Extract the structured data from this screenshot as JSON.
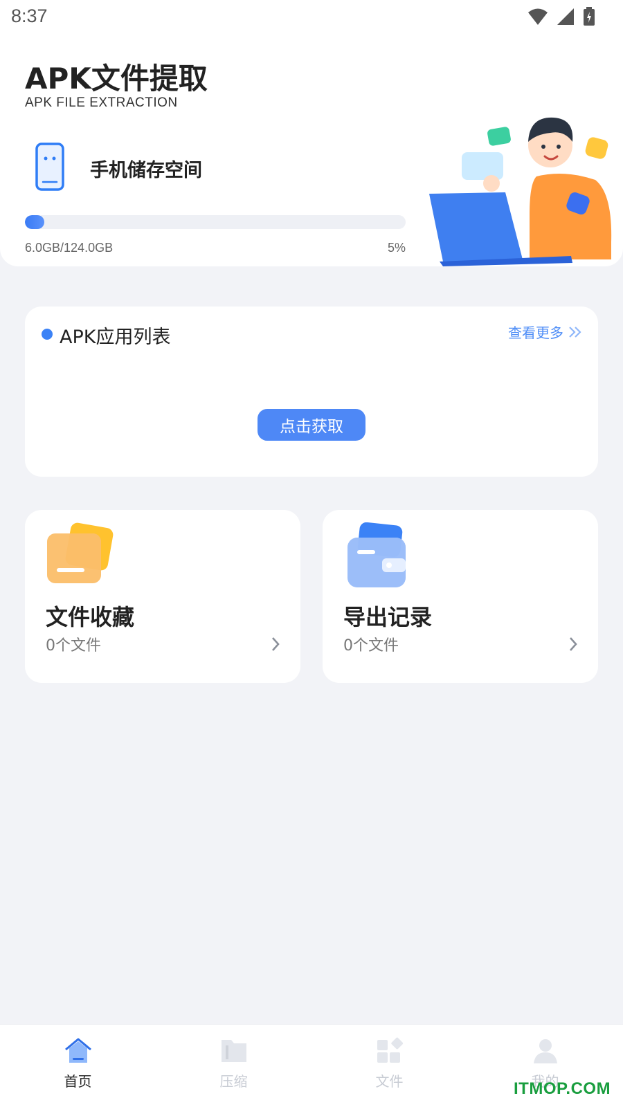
{
  "status_bar": {
    "time": "8:37"
  },
  "header": {
    "title": "APK文件提取",
    "subtitle": "APK FILE EXTRACTION"
  },
  "storage": {
    "label": "手机储存空间",
    "used_text": "6.0GB/124.0GB",
    "percent_text": "5%",
    "progress_fraction": 0.05
  },
  "apk_list": {
    "title": "APK应用列表",
    "more_label": "查看更多",
    "fetch_button": "点击获取"
  },
  "features": [
    {
      "title": "文件收藏",
      "count": "0个文件",
      "icon": "folder-icon"
    },
    {
      "title": "导出记录",
      "count": "0个文件",
      "icon": "wallet-icon"
    }
  ],
  "bottom_nav": {
    "items": [
      {
        "label": "首页",
        "icon": "home-icon",
        "active": true
      },
      {
        "label": "压缩",
        "icon": "compress-icon",
        "active": false
      },
      {
        "label": "文件",
        "icon": "files-icon",
        "active": false
      },
      {
        "label": "我的",
        "icon": "profile-icon",
        "active": false
      }
    ]
  },
  "watermark": "ITMOP.COM",
  "colors": {
    "accent": "#4e88f6",
    "background": "#f2f3f7",
    "progress": "#3a7bf5",
    "watermark": "#1a9e3f"
  }
}
